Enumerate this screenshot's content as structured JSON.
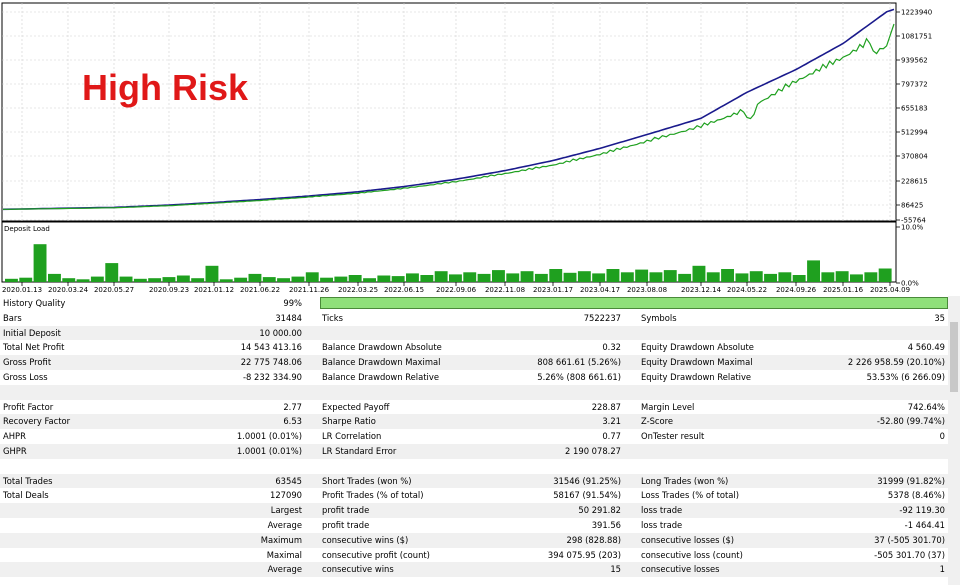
{
  "chart_data": [
    {
      "type": "line",
      "title": "High Risk",
      "xlabel": "",
      "ylabel": "",
      "ylim": [
        0,
        1300000
      ],
      "y_ticks": [
        "1223940",
        "1081751",
        "939562",
        "797372",
        "655183",
        "512994",
        "370804",
        "228615",
        "86425",
        "-55764"
      ],
      "x_ticks": [
        "2020.01.13",
        "2020.03.24",
        "2020.05.27",
        "2020.09.23",
        "2021.01.12",
        "2021.06.22",
        "2021.11.26",
        "2022.03.25",
        "2022.06.15",
        "2022.09.06",
        "2022.11.08",
        "2023.01.17",
        "2023.04.17",
        "2023.08.08",
        "2023.12.14",
        "2024.05.22",
        "2024.09.26",
        "2025.01.16",
        "2025.04.09"
      ],
      "grid": true,
      "series": [
        {
          "color": "#1a1a8c",
          "x": [
            "2020.01.13",
            "2020.05.27",
            "2020.09.23",
            "2021.01.12",
            "2021.06.22",
            "2021.11.26",
            "2022.03.25",
            "2022.06.15",
            "2022.09.06",
            "2022.11.08",
            "2023.01.17",
            "2023.04.17",
            "2023.08.08",
            "2023.12.14",
            "2024.05.22",
            "2024.09.26",
            "2025.01.16",
            "2025.04.09"
          ],
          "values": [
            10000,
            22000,
            36000,
            52000,
            70000,
            92000,
            118000,
            150000,
            195000,
            248000,
            310000,
            385000,
            470000,
            570000,
            730000,
            870000,
            1030000,
            1240000
          ]
        },
        {
          "color": "#1fa01f",
          "x": [
            "2020.01.13",
            "2020.05.27",
            "2020.09.23",
            "2021.01.12",
            "2021.06.22",
            "2021.11.26",
            "2022.03.25",
            "2022.06.15",
            "2022.09.06",
            "2022.11.08",
            "2023.01.17",
            "2023.04.17",
            "2023.08.08",
            "2023.12.14",
            "2024.05.22",
            "2024.09.26",
            "2025.01.16",
            "2025.04.09"
          ],
          "values": [
            10000,
            20000,
            33000,
            49000,
            66000,
            88000,
            112000,
            143000,
            185000,
            236000,
            290000,
            358000,
            440000,
            535000,
            640000,
            820000,
            970000,
            1150000
          ]
        }
      ]
    },
    {
      "type": "bar",
      "title": "Deposit Load",
      "y_ticks": [
        "10.0%",
        "0.0%"
      ],
      "ylim": [
        0,
        10
      ],
      "x_ticks": [
        "2020.01.13",
        "2025.04.09"
      ],
      "values": [
        0.6,
        0.8,
        7.0,
        1.5,
        0.7,
        0.5,
        1.0,
        3.5,
        1.0,
        0.6,
        0.7,
        0.9,
        1.2,
        0.7,
        3.0,
        0.5,
        0.8,
        1.5,
        0.9,
        0.7,
        1.0,
        1.8,
        0.8,
        1.0,
        1.3,
        0.7,
        1.2,
        1.1,
        1.6,
        1.3,
        2.0,
        1.4,
        1.8,
        1.5,
        2.2,
        1.6,
        2.0,
        1.5,
        2.4,
        1.7,
        2.0,
        1.6,
        2.4,
        1.8,
        2.3,
        1.8,
        2.2,
        1.5,
        3.0,
        1.8,
        2.4,
        1.6,
        2.0,
        1.5,
        1.8,
        1.3,
        4.0,
        1.8,
        2.0,
        1.4,
        1.8,
        2.5
      ]
    }
  ],
  "report": {
    "history_quality": {
      "label": "History Quality",
      "value": "99%",
      "fraction": 0.99
    },
    "rows": [
      {
        "c1": "Bars",
        "v1": "31484",
        "l2": "Ticks",
        "v2": "7522237",
        "l3": "Symbols",
        "v3": "35"
      },
      {
        "c1": "Initial Deposit",
        "v1": "10 000.00",
        "l2": "",
        "v2": "",
        "l3": "",
        "v3": ""
      },
      {
        "c1": "Total Net Profit",
        "v1": "14 543 413.16",
        "l2": "Balance Drawdown Absolute",
        "v2": "0.32",
        "l3": "Equity Drawdown Absolute",
        "v3": "4 560.49"
      },
      {
        "c1": "Gross Profit",
        "v1": "22 775 748.06",
        "l2": "Balance Drawdown Maximal",
        "v2": "808 661.61 (5.26%)",
        "l3": "Equity Drawdown Maximal",
        "v3": "2 226 958.59 (20.10%)"
      },
      {
        "c1": "Gross Loss",
        "v1": "-8 232 334.90",
        "l2": "Balance Drawdown Relative",
        "v2": "5.26% (808 661.61)",
        "l3": "Equity Drawdown Relative",
        "v3": "53.53% (6 266.09)"
      },
      {
        "c1": "",
        "v1": "",
        "l2": "",
        "v2": "",
        "l3": "",
        "v3": ""
      },
      {
        "c1": "Profit Factor",
        "v1": "2.77",
        "l2": "Expected Payoff",
        "v2": "228.87",
        "l3": "Margin Level",
        "v3": "742.64%"
      },
      {
        "c1": "Recovery Factor",
        "v1": "6.53",
        "l2": "Sharpe Ratio",
        "v2": "3.21",
        "l3": "Z-Score",
        "v3": "-52.80 (99.74%)"
      },
      {
        "c1": "AHPR",
        "v1": "1.0001 (0.01%)",
        "l2": "LR Correlation",
        "v2": "0.77",
        "l3": "OnTester result",
        "v3": "0"
      },
      {
        "c1": "GHPR",
        "v1": "1.0001 (0.01%)",
        "l2": "LR Standard Error",
        "v2": "2 190 078.27",
        "l3": "",
        "v3": ""
      },
      {
        "c1": "",
        "v1": "",
        "l2": "",
        "v2": "",
        "l3": "",
        "v3": ""
      },
      {
        "c1": "Total Trades",
        "v1": "63545",
        "l2": "Short Trades (won %)",
        "v2": "31546 (91.25%)",
        "l3": "Long Trades (won %)",
        "v3": "31999 (91.82%)"
      },
      {
        "c1": "Total Deals",
        "v1": "127090",
        "l2": "Profit Trades (% of total)",
        "v2": "58167 (91.54%)",
        "l3": "Loss Trades (% of total)",
        "v3": "5378 (8.46%)"
      },
      {
        "c1": "",
        "v1": "Largest",
        "l2": "profit trade",
        "v2": "50 291.82",
        "l3": "loss trade",
        "v3": "-92 119.30"
      },
      {
        "c1": "",
        "v1": "Average",
        "l2": "profit trade",
        "v2": "391.56",
        "l3": "loss trade",
        "v3": "-1 464.41"
      },
      {
        "c1": "",
        "v1": "Maximum",
        "l2": "consecutive wins ($)",
        "v2": "298 (828.88)",
        "l3": "consecutive losses ($)",
        "v3": "37 (-505 301.70)"
      },
      {
        "c1": "",
        "v1": "Maximal",
        "l2": "consecutive profit (count)",
        "v2": "394 075.95 (203)",
        "l3": "consecutive loss (count)",
        "v3": "-505 301.70 (37)"
      },
      {
        "c1": "",
        "v1": "Average",
        "l2": "consecutive wins",
        "v2": "15",
        "l3": "consecutive losses",
        "v3": "1"
      }
    ]
  }
}
